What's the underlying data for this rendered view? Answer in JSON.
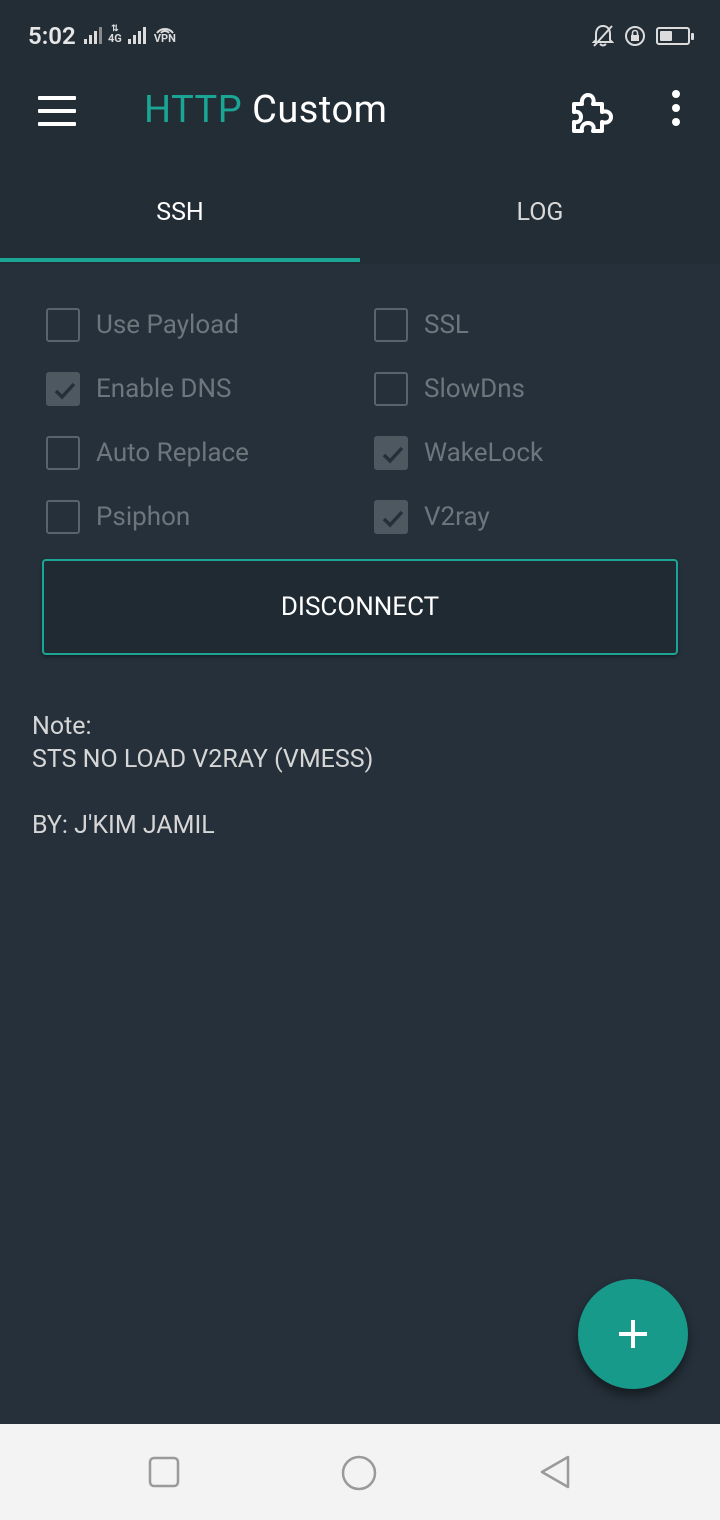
{
  "status_bar": {
    "time": "5:02",
    "network": "4G",
    "vpn": "VPN"
  },
  "app_bar": {
    "title_accent": "HTTP",
    "title_rest": "Custom",
    "accent_color": "#1aa595"
  },
  "tabs": [
    {
      "label": "SSH",
      "selected": true
    },
    {
      "label": "LOG",
      "selected": false
    }
  ],
  "options": {
    "use_payload": {
      "label": "Use Payload",
      "checked": false
    },
    "ssl": {
      "label": "SSL",
      "checked": false
    },
    "enable_dns": {
      "label": "Enable DNS",
      "checked": true
    },
    "slowdns": {
      "label": "SlowDns",
      "checked": false
    },
    "auto_replace": {
      "label": "Auto Replace",
      "checked": false
    },
    "wakelock": {
      "label": "WakeLock",
      "checked": true
    },
    "psiphon": {
      "label": "Psiphon",
      "checked": false
    },
    "v2ray": {
      "label": "V2ray",
      "checked": true
    }
  },
  "connect_button": {
    "label": "DISCONNECT"
  },
  "note": {
    "heading": "Note:",
    "line1": "STS NO LOAD V2RAY (VMESS)",
    "line2": "BY: J'KIM JAMIL"
  },
  "fab": {
    "icon": "plus-icon"
  },
  "nav_bar": {
    "recents": "square-icon",
    "home": "circle-icon",
    "back": "triangle-back-icon"
  }
}
